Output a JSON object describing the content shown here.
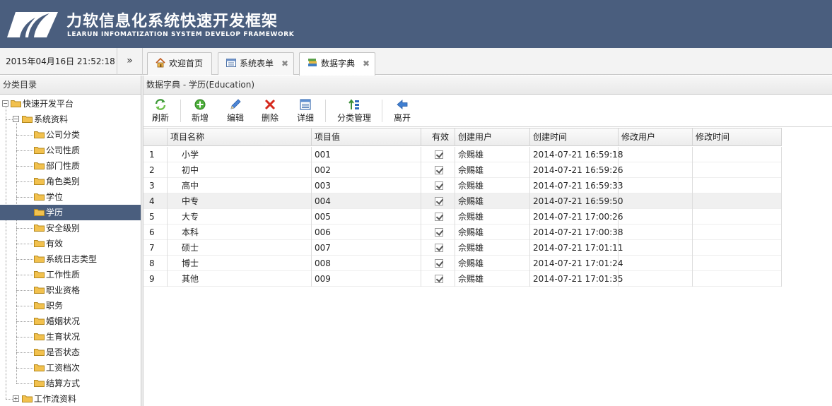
{
  "header": {
    "title": "力软信息化系统快速开发框架",
    "subtitle": "LEARUN INFOMATIZATION SYSTEM DEVELOP FRAMEWORK"
  },
  "topbar": {
    "datetime": "2015年04月16日 21:52:18",
    "expand_glyph": "»",
    "tabs": [
      {
        "label": "欢迎首页",
        "icon": "home-icon",
        "closable": false
      },
      {
        "label": "系统表单",
        "icon": "form-icon",
        "closable": true
      },
      {
        "label": "数据字典",
        "icon": "dictionary-icon",
        "closable": true,
        "active": true
      }
    ],
    "close_glyph": "✖"
  },
  "sidebar": {
    "title": "分类目录",
    "tree": [
      {
        "label": "快速开发平台",
        "level": 0,
        "toggle": "−"
      },
      {
        "label": "系统资料",
        "level": 1,
        "toggle": "−"
      },
      {
        "label": "公司分类",
        "level": 2
      },
      {
        "label": "公司性质",
        "level": 2
      },
      {
        "label": "部门性质",
        "level": 2
      },
      {
        "label": "角色类别",
        "level": 2
      },
      {
        "label": "学位",
        "level": 2
      },
      {
        "label": "学历",
        "level": 2,
        "selected": true
      },
      {
        "label": "安全级别",
        "level": 2
      },
      {
        "label": "有效",
        "level": 2
      },
      {
        "label": "系统日志类型",
        "level": 2
      },
      {
        "label": "工作性质",
        "level": 2
      },
      {
        "label": "职业资格",
        "level": 2
      },
      {
        "label": "职务",
        "level": 2
      },
      {
        "label": "婚姻状况",
        "level": 2
      },
      {
        "label": "生育状况",
        "level": 2
      },
      {
        "label": "是否状态",
        "level": 2
      },
      {
        "label": "工资档次",
        "level": 2
      },
      {
        "label": "结算方式",
        "level": 2
      },
      {
        "label": "工作流资料",
        "level": 1,
        "toggle": "+"
      }
    ]
  },
  "main": {
    "title": "数据字典 - 学历(Education)",
    "toolbar": [
      {
        "label": "刷新",
        "icon": "refresh-icon"
      },
      {
        "label": "新增",
        "icon": "add-icon"
      },
      {
        "label": "编辑",
        "icon": "edit-icon"
      },
      {
        "label": "删除",
        "icon": "delete-icon"
      },
      {
        "label": "详细",
        "icon": "detail-icon"
      },
      {
        "label": "分类管理",
        "icon": "category-manage-icon"
      },
      {
        "label": "离开",
        "icon": "exit-icon"
      }
    ],
    "grid": {
      "columns": [
        "项目名称",
        "项目值",
        "有效",
        "创建用户",
        "创建时间",
        "修改用户",
        "修改时间"
      ],
      "rows": [
        {
          "num": "1",
          "name": "小学",
          "value": "001",
          "valid": true,
          "creator": "佘赐雄",
          "created": "2014-07-21 16:59:18",
          "modifier": "",
          "modified": ""
        },
        {
          "num": "2",
          "name": "初中",
          "value": "002",
          "valid": true,
          "creator": "佘赐雄",
          "created": "2014-07-21 16:59:26",
          "modifier": "",
          "modified": ""
        },
        {
          "num": "3",
          "name": "高中",
          "value": "003",
          "valid": true,
          "creator": "佘赐雄",
          "created": "2014-07-21 16:59:33",
          "modifier": "",
          "modified": ""
        },
        {
          "num": "4",
          "name": "中专",
          "value": "004",
          "valid": true,
          "creator": "佘赐雄",
          "created": "2014-07-21 16:59:50",
          "modifier": "",
          "modified": "",
          "highlight": true
        },
        {
          "num": "5",
          "name": "大专",
          "value": "005",
          "valid": true,
          "creator": "佘赐雄",
          "created": "2014-07-21 17:00:26",
          "modifier": "",
          "modified": ""
        },
        {
          "num": "6",
          "name": "本科",
          "value": "006",
          "valid": true,
          "creator": "佘赐雄",
          "created": "2014-07-21 17:00:38",
          "modifier": "",
          "modified": ""
        },
        {
          "num": "7",
          "name": "硕士",
          "value": "007",
          "valid": true,
          "creator": "佘赐雄",
          "created": "2014-07-21 17:01:11",
          "modifier": "",
          "modified": ""
        },
        {
          "num": "8",
          "name": "博士",
          "value": "008",
          "valid": true,
          "creator": "佘赐雄",
          "created": "2014-07-21 17:01:24",
          "modifier": "",
          "modified": ""
        },
        {
          "num": "9",
          "name": "其他",
          "value": "009",
          "valid": true,
          "creator": "佘赐雄",
          "created": "2014-07-21 17:01:35",
          "modifier": "",
          "modified": ""
        }
      ]
    }
  },
  "colors": {
    "header_bg": "#4a5e7e",
    "selected_bg": "#4a5e7e",
    "folder": "#f2c14e"
  }
}
